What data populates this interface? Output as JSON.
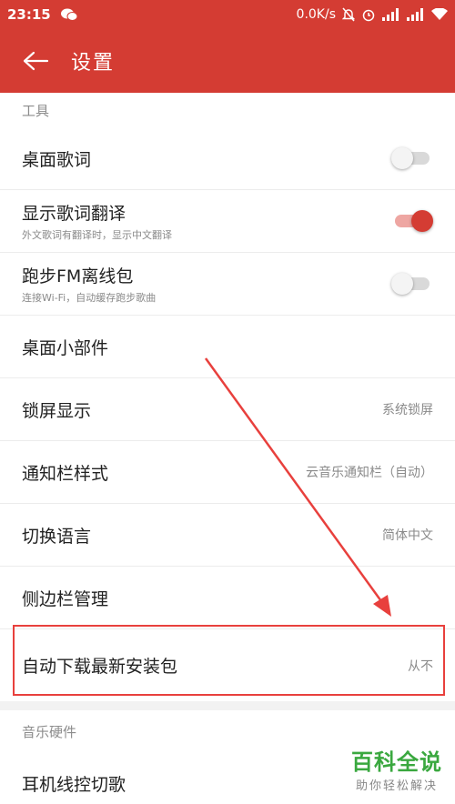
{
  "status_bar": {
    "time": "23:15",
    "net_speed": "0.0K/s"
  },
  "header": {
    "title": "设置"
  },
  "sections": {
    "tools_label": "工具",
    "hardware_label": "音乐硬件"
  },
  "settings": {
    "desktop_lyrics": {
      "label": "桌面歌词",
      "enabled": false
    },
    "lyrics_translation": {
      "label": "显示歌词翻译",
      "sub": "外文歌词有翻译时，显示中文翻译",
      "enabled": true
    },
    "run_fm_offline": {
      "label": "跑步FM离线包",
      "sub": "连接Wi-Fi，自动缓存跑步歌曲",
      "enabled": false
    },
    "desktop_widget": {
      "label": "桌面小部件"
    },
    "lockscreen": {
      "label": "锁屏显示",
      "value": "系统锁屏"
    },
    "notification_style": {
      "label": "通知栏样式",
      "value": "云音乐通知栏（自动）"
    },
    "language": {
      "label": "切换语言",
      "value": "简体中文"
    },
    "sidebar_manage": {
      "label": "侧边栏管理"
    },
    "auto_download": {
      "label": "自动下载最新安装包",
      "value": "从不"
    },
    "headset_control": {
      "label": "耳机线控切歌"
    }
  },
  "watermark": {
    "main": "百科全说",
    "sub": "助你轻松解决"
  },
  "colors": {
    "brand_red": "#d43c33",
    "annotation_red": "#e8403d",
    "watermark_green": "#3aa83f"
  }
}
